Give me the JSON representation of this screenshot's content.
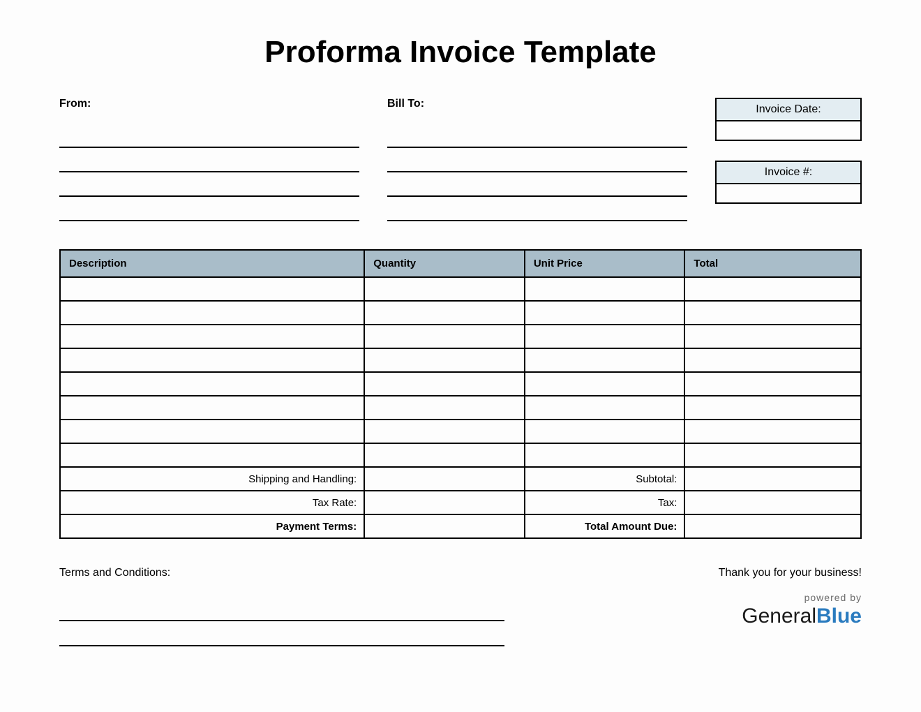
{
  "title": "Proforma Invoice Template",
  "from_label": "From:",
  "billto_label": "Bill To:",
  "invoice_date_label": "Invoice Date:",
  "invoice_date_value": "",
  "invoice_number_label": "Invoice #:",
  "invoice_number_value": "",
  "table": {
    "headers": {
      "description": "Description",
      "quantity": "Quantity",
      "unit_price": "Unit Price",
      "total": "Total"
    },
    "rows": [
      {
        "description": "",
        "quantity": "",
        "unit_price": "",
        "total": ""
      },
      {
        "description": "",
        "quantity": "",
        "unit_price": "",
        "total": ""
      },
      {
        "description": "",
        "quantity": "",
        "unit_price": "",
        "total": ""
      },
      {
        "description": "",
        "quantity": "",
        "unit_price": "",
        "total": ""
      },
      {
        "description": "",
        "quantity": "",
        "unit_price": "",
        "total": ""
      },
      {
        "description": "",
        "quantity": "",
        "unit_price": "",
        "total": ""
      },
      {
        "description": "",
        "quantity": "",
        "unit_price": "",
        "total": ""
      },
      {
        "description": "",
        "quantity": "",
        "unit_price": "",
        "total": ""
      }
    ],
    "summary": {
      "shipping_label": "Shipping and Handling:",
      "shipping_value": "",
      "subtotal_label": "Subtotal:",
      "subtotal_value": "",
      "taxrate_label": "Tax Rate:",
      "taxrate_value": "",
      "tax_label": "Tax:",
      "tax_value": "",
      "payment_terms_label": "Payment Terms:",
      "payment_terms_value": "",
      "total_due_label": "Total Amount Due:",
      "total_due_value": ""
    }
  },
  "terms_label": "Terms and Conditions:",
  "thanks": "Thank you for your business!",
  "powered_by": "powered by",
  "brand_general": "General",
  "brand_blue": "Blue"
}
